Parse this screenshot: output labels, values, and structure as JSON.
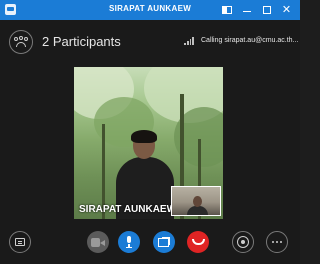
{
  "window": {
    "title": "SIRAPAT AUNKAEW",
    "controls": [
      "layout-icon",
      "minimize-icon",
      "maximize-icon",
      "close-icon"
    ]
  },
  "header": {
    "participants_label": "2 Participants",
    "calling_status": "Calling sirapat.au@cmu.ac.th..."
  },
  "video": {
    "caller_name": "SIRAPAT AUNKAEW"
  },
  "controls": {
    "chat": "chat-icon",
    "video": "video-camera-icon",
    "mic": "microphone-icon",
    "share": "share-screen-icon",
    "hangup": "hang-up-icon",
    "devices": "call-devices-icon",
    "more": "more-options-icon"
  },
  "colors": {
    "titlebar": "#1b7cd6",
    "background": "#1a1a1a",
    "accent": "#1b7cd6",
    "hangup": "#e02424"
  }
}
